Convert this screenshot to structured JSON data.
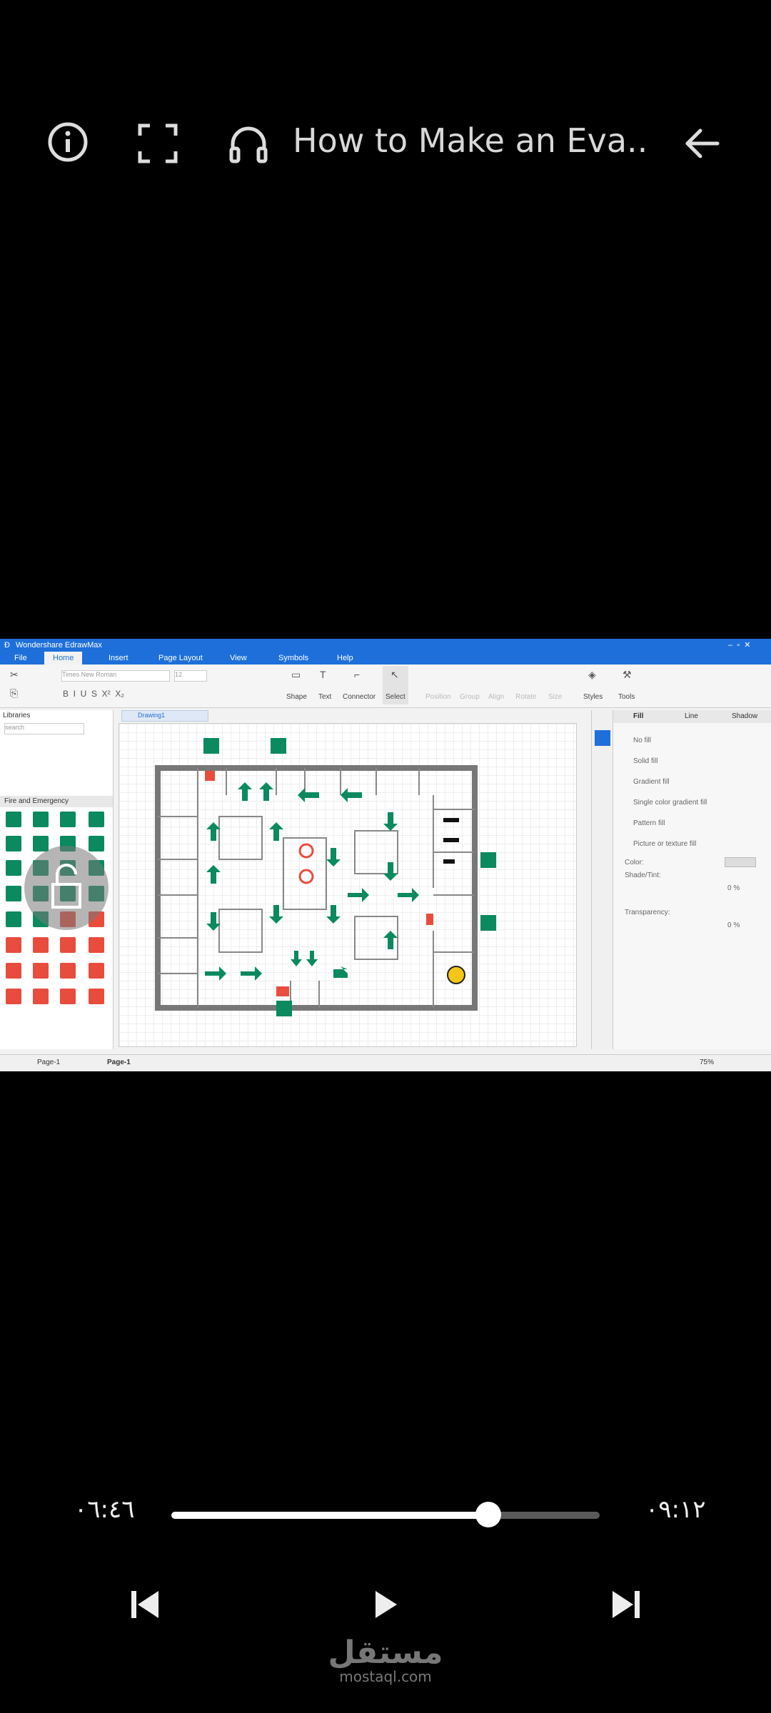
{
  "header": {
    "title": "How to Make an Eva.....",
    "info_icon": "info-icon",
    "fullscreen_icon": "fullscreen-icon",
    "audio_icon": "headphones-icon",
    "back_icon": "arrow-left-icon"
  },
  "app": {
    "window_title": "Wondershare EdrawMax",
    "menu": [
      "File",
      "Home",
      "Insert",
      "Page Layout",
      "View",
      "Symbols",
      "Help"
    ],
    "active_menu": "Home",
    "font_name": "Times New Roman",
    "font_size": "12",
    "ribbon_tools": [
      "Shape",
      "Text",
      "Connector",
      "Select"
    ],
    "ribbon_right": [
      "Position",
      "Group",
      "Align",
      "Rotate",
      "Size",
      "Styles",
      "Tools"
    ],
    "libraries_label": "Libraries",
    "search_placeholder": "search",
    "library_name": "Fire and Emergency",
    "doc_tab": "Drawing1",
    "panel_tabs": [
      "Fill",
      "Line",
      "Shadow"
    ],
    "fill_options": [
      "No fill",
      "Solid fill",
      "Gradient fill",
      "Single color gradient fill",
      "Pattern fill",
      "Picture or texture fill"
    ],
    "color_label": "Color:",
    "shade_label": "Shade/Tint:",
    "shade_value": "0 %",
    "transparency_label": "Transparency:",
    "transparency_value": "0 %",
    "page_selector": "Page-1",
    "page_tab": "Page-1",
    "zoom": "75%"
  },
  "player": {
    "elapsed": "٠٦:٤٦",
    "total": "٠٩:١٢",
    "progress_fraction": 0.74,
    "prev_icon": "skip-previous-icon",
    "play_icon": "play-icon",
    "next_icon": "skip-next-icon"
  },
  "watermark": {
    "arabic": "مستقل",
    "latin": "mostaql.com"
  }
}
